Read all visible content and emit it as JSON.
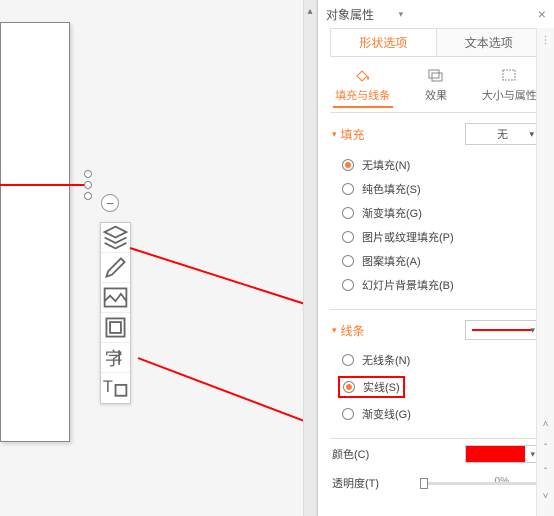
{
  "panel": {
    "title": "对象属性",
    "tabs": {
      "shape": "形状选项",
      "text": "文本选项"
    },
    "subtabs": {
      "fill": "填充与线条",
      "effect": "效果",
      "size": "大小与属性"
    }
  },
  "fill": {
    "section": "填充",
    "dropdown": "无",
    "options": {
      "none": "无填充(N)",
      "solid": "纯色填充(S)",
      "gradient": "渐变填充(G)",
      "picture": "图片或纹理填充(P)",
      "pattern": "图案填充(A)",
      "slidebg": "幻灯片背景填充(B)"
    }
  },
  "line": {
    "section": "线条",
    "options": {
      "none": "无线条(N)",
      "solid": "实线(S)",
      "gradient": "渐变线(G)"
    }
  },
  "color": {
    "label": "颜色(C)",
    "value": "#ff0000"
  },
  "opacity": {
    "label": "透明度(T)",
    "value": "0%"
  }
}
